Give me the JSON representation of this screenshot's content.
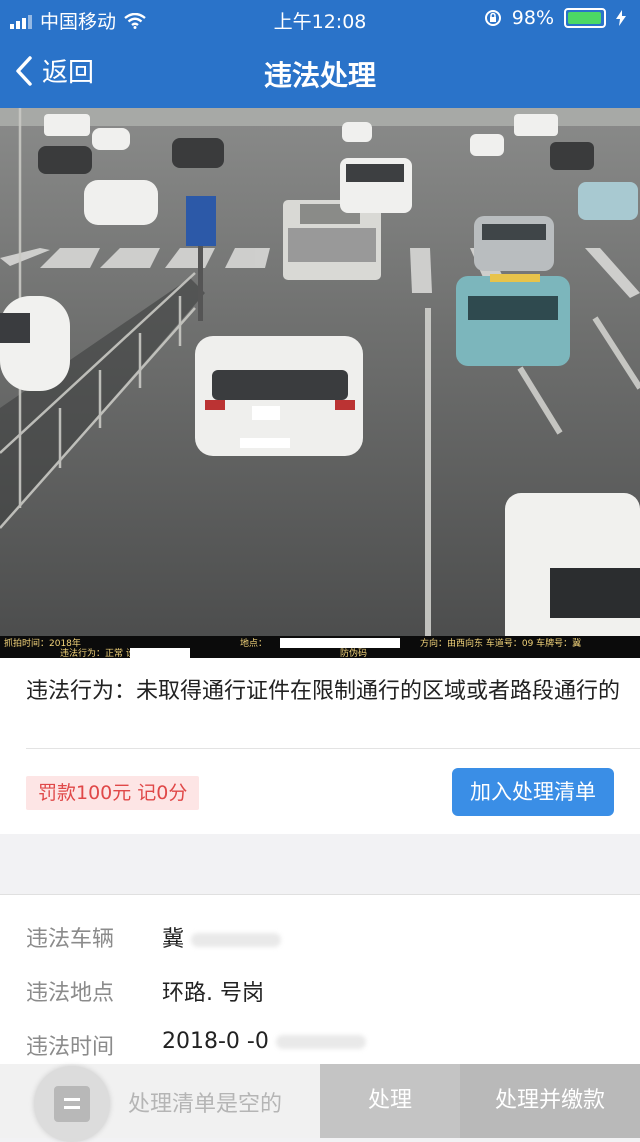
{
  "status_bar": {
    "carrier": "中国移动",
    "time": "上午12:08",
    "battery": "98%",
    "battery_level": 0.98
  },
  "nav": {
    "back_label": "返回",
    "title": "违法处理"
  },
  "photo": {
    "caption_line1": "抓拍时间：2018年",
    "caption_line1b": "地点：",
    "caption_line1c": "方向：由西向东  车道号：09  车牌号：冀",
    "caption_line2": "违法行为：正常  设备编号",
    "caption_line2b": "防伪码"
  },
  "violation": {
    "behavior_label": "违法行为：",
    "behavior_text": "未取得通行证件在限制通行的区域或者路段通行的",
    "fine": "罚款100元  记0分",
    "add_button": "加入处理清单"
  },
  "details": {
    "vehicle_label": "违法车辆",
    "vehicle_value": "冀",
    "location_label": "违法地点",
    "location_value": "环路.   号岗",
    "time_label": "违法时间",
    "time_value": "2018-0  -0"
  },
  "bottom_bar": {
    "empty_text": "处理清单是空的",
    "process_button": "处理",
    "process_pay_button": "处理并缴款"
  },
  "colors": {
    "header": "#2a73c9",
    "accent_button": "#3a8ee6",
    "fine_text": "#e04848",
    "fine_bg": "#fde5e5",
    "battery": "#4cd964"
  }
}
